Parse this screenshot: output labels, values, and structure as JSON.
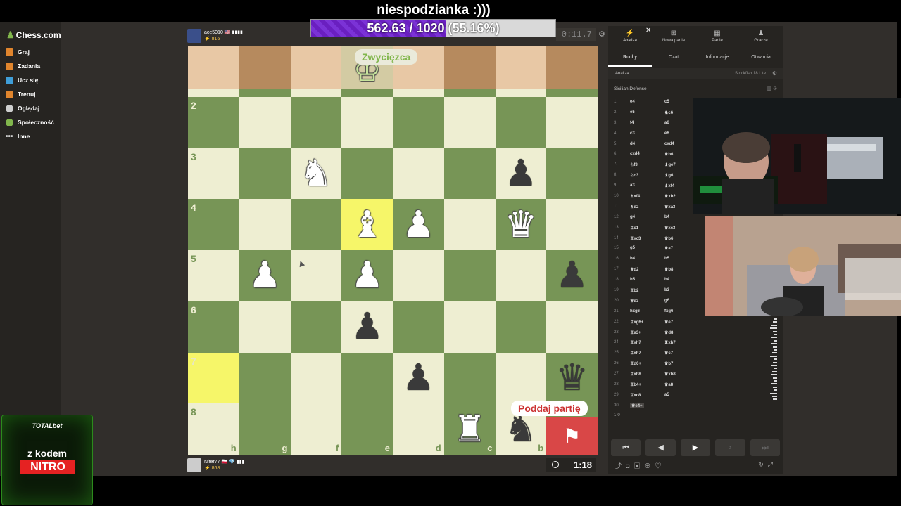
{
  "overlay": {
    "title": "niespodzianka :)))",
    "goal_text": "562.63 / 1020 (55.16%)",
    "goal_fraction": 0.5516
  },
  "sidebar": {
    "logo": "Chess.com",
    "items": [
      {
        "label": "Graj",
        "icon": "play-icon",
        "color": "#e0852d"
      },
      {
        "label": "Zadania",
        "icon": "puzzle-icon",
        "color": "#e0852d"
      },
      {
        "label": "Ucz się",
        "icon": "learn-icon",
        "color": "#3f9ed8"
      },
      {
        "label": "Trenuj",
        "icon": "train-icon",
        "color": "#e0852d"
      },
      {
        "label": "Oglądaj",
        "icon": "watch-icon",
        "color": "#cfcfcf"
      },
      {
        "label": "Społeczność",
        "icon": "community-icon",
        "color": "#81b64c"
      },
      {
        "label": "Inne",
        "icon": "more-icon",
        "color": "#cfcfcf"
      }
    ]
  },
  "players": {
    "top": {
      "name": "ace5010 🇺🇸 ▮▮▮▮",
      "rating": "⚡ 816",
      "clock": "0:11.7"
    },
    "bottom": {
      "name": "Niter77 🇵🇱 💎 ▮▮▮",
      "rating": "⚡ 868",
      "clock": "1:18"
    }
  },
  "board": {
    "winner_label": "Zwycięzca",
    "resign_label": "Poddaj partię",
    "ranks": [
      "2",
      "3",
      "4",
      "5",
      "6",
      "7",
      "8"
    ],
    "files": [
      "h",
      "g",
      "f",
      "e",
      "d",
      "c",
      "b",
      "a"
    ],
    "highlight_color": "#f6f669",
    "light_color": "#eeeed2",
    "dark_color": "#779556"
  },
  "panel": {
    "top_tabs": [
      {
        "label": "Analiza",
        "icon": "analysis-icon"
      },
      {
        "label": "Nowa partia",
        "icon": "plus-icon"
      },
      {
        "label": "Partie",
        "icon": "games-icon"
      },
      {
        "label": "Gracze",
        "icon": "players-icon"
      }
    ],
    "sub_tabs": [
      "Ruchy",
      "Czat",
      "Informacje",
      "Otwarcia"
    ],
    "analysis_label": "Analiza",
    "engine": "| Stockfish 18 Lite",
    "opening": "Sicilian Defense",
    "moves": [
      [
        "1.",
        "e4",
        "c5"
      ],
      [
        "2.",
        "e5",
        "♞c6"
      ],
      [
        "3.",
        "f4",
        "a6"
      ],
      [
        "4.",
        "c3",
        "e6"
      ],
      [
        "5.",
        "d4",
        "cxd4"
      ],
      [
        "6.",
        "cxd4",
        "♛b6"
      ],
      [
        "7.",
        "♘f3",
        "♝ge7"
      ],
      [
        "8.",
        "♘c3",
        "♝g6"
      ],
      [
        "9.",
        "a3",
        "♝xf4"
      ],
      [
        "10.",
        "♗xf4",
        "♛xb2"
      ],
      [
        "11.",
        "♗d2",
        "♛xa3"
      ],
      [
        "12.",
        "g4",
        "b4"
      ],
      [
        "13.",
        "♖c1",
        "♛xc3"
      ],
      [
        "14.",
        "♖xc3",
        "♛b6"
      ],
      [
        "15.",
        "g5",
        "♛a7"
      ],
      [
        "16.",
        "h4",
        "b5"
      ],
      [
        "17.",
        "♕d2",
        "♛b8"
      ],
      [
        "18.",
        "h5",
        "b4"
      ],
      [
        "19.",
        "♖b2",
        "b3"
      ],
      [
        "20.",
        "♕d3",
        "g6"
      ],
      [
        "21.",
        "hxg6",
        "fxg6"
      ],
      [
        "22.",
        "♖xg6+",
        "♛e7"
      ],
      [
        "23.",
        "♖a3+",
        "♛d8"
      ],
      [
        "24.",
        "♖xh7",
        "♜xh7"
      ],
      [
        "25.",
        "♖xh7",
        "♛c7"
      ],
      [
        "26.",
        "♖d6+",
        "♛b7"
      ],
      [
        "27.",
        "♖xb8",
        "♛xb8"
      ],
      [
        "28.",
        "♖b4+",
        "♛a8"
      ],
      [
        "29.",
        "♖xc8",
        "a5"
      ],
      [
        "30.",
        "♕e4+",
        ""
      ]
    ],
    "result": "1-0"
  },
  "sponsor": {
    "brand": "TOTALbet",
    "line1": "z kodem",
    "code": "NITRO"
  }
}
